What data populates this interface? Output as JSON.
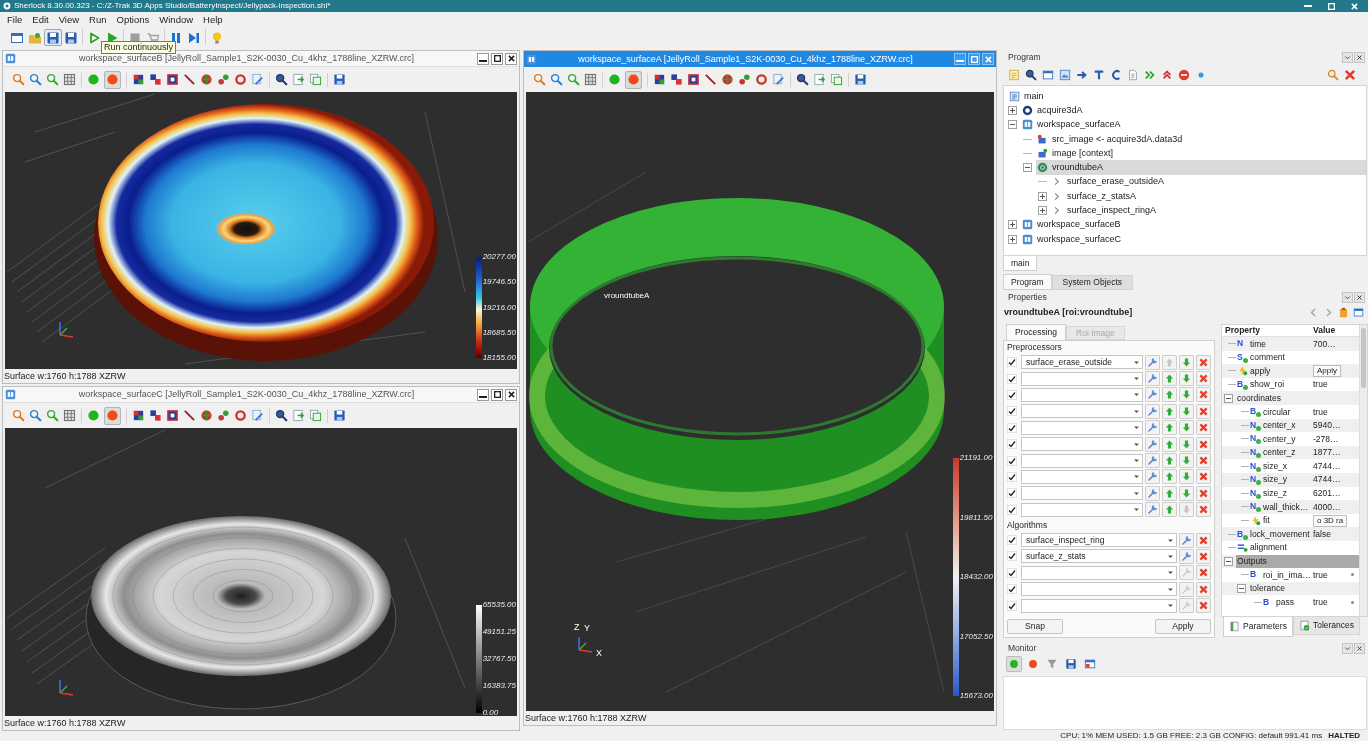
{
  "window": {
    "title": "Sherlock 8.30.00.323 - C:/Z-Trak 3D Apps Studio/BatteryInspect/Jellypack-inspection.shl*"
  },
  "menu": [
    "File",
    "Edit",
    "View",
    "Run",
    "Options",
    "Window",
    "Help"
  ],
  "toolbar": [
    {
      "kind": "new",
      "disabled": false,
      "pressed": false
    },
    {
      "kind": "open",
      "disabled": false,
      "pressed": false
    },
    {
      "kind": "save",
      "disabled": false,
      "pressed": true
    },
    {
      "kind": "save_as",
      "disabled": false,
      "pressed": false
    },
    {
      "kind": "run",
      "disabled": false,
      "pressed": false
    },
    {
      "kind": "run_continuous",
      "disabled": false,
      "pressed": false,
      "tooltip": "Run continuously"
    },
    {
      "kind": "stop",
      "disabled": true,
      "pressed": false
    },
    {
      "kind": "abort",
      "disabled": true,
      "pressed": false
    },
    {
      "kind": "pause",
      "disabled": false,
      "pressed": false
    },
    {
      "kind": "step",
      "disabled": false,
      "pressed": false
    },
    {
      "kind": "hint",
      "disabled": false,
      "pressed": false
    }
  ],
  "left_viewers": [
    {
      "title": "workspace_surfaceB [JellyRoll_Sample1_S2K-0030_Cu_4khz_1788line_XZRW.crc]",
      "active": false,
      "kind": "height_map",
      "capture_pressed": true,
      "scale": [
        "20277.00",
        "19746.50",
        "19216.00",
        "18685.50",
        "18155.00"
      ],
      "status": "Surface w:1760 h:1788 XZRW"
    },
    {
      "title": "workspace_surfaceC [JellyRoll_Sample1_S2K-0030_Cu_4khz_1788line_XZRW.crc]",
      "active": false,
      "kind": "intensity_map",
      "capture_pressed": true,
      "scale": [
        "65535.00",
        "49151.25",
        "32767.50",
        "16383.75",
        "0.00"
      ],
      "status": "Surface w:1760 h:1788 XZRW"
    }
  ],
  "main_viewer": {
    "title": "workspace_surfaceA [JellyRoll_Sample1_S2K-0030_Cu_4khz_1788line_XZRW.crc]",
    "active": true,
    "kind": "roi_view",
    "capture_pressed": true,
    "roi_label": "vroundtubeA",
    "axis_labels": [
      "Z",
      "Y",
      "X"
    ],
    "scale": [
      "21191.00",
      "19811.50",
      "18432.00",
      "17052.50",
      "15673.00"
    ],
    "status": "Surface w:1760 h:1788 XZRW"
  },
  "program": {
    "title": "Program",
    "tree": [
      {
        "label": "main",
        "kind": "program",
        "selected": false
      },
      {
        "label": "acquire3dA",
        "kind": "acquire",
        "expanded": false,
        "selected": false
      },
      {
        "label": "workspace_surfaceA",
        "kind": "workspace",
        "expanded": true,
        "selected": false,
        "children": [
          {
            "label": "src_image <- acquire3dA.data3d",
            "kind": "input",
            "selected": false
          },
          {
            "label": "image [context]",
            "kind": "output",
            "selected": false
          },
          {
            "label": "vroundtubeA",
            "kind": "roi",
            "expanded": true,
            "selected": true,
            "children": [
              {
                "label": "surface_erase_outsideA",
                "kind": "tool",
                "selected": false
              },
              {
                "label": "surface_z_statsA",
                "kind": "tool",
                "expanded": false,
                "selected": false
              },
              {
                "label": "surface_inspect_ringA",
                "kind": "tool",
                "expanded": false,
                "selected": false
              }
            ]
          }
        ]
      },
      {
        "label": "workspace_surfaceB",
        "kind": "workspace",
        "expanded": false,
        "selected": false
      },
      {
        "label": "workspace_surfaceC",
        "kind": "workspace",
        "expanded": false,
        "selected": false
      }
    ],
    "script_tabs": [
      {
        "label": "main",
        "selected": true
      }
    ],
    "tabs": [
      {
        "label": "Program",
        "selected": true
      },
      {
        "label": "System Objects",
        "selected": false
      }
    ]
  },
  "properties": {
    "title": "Properties",
    "object": "vroundtubeA [roi:vroundtube]",
    "tabs": [
      {
        "label": "Processing",
        "selected": true
      },
      {
        "label": "Roi Image",
        "selected": false
      }
    ],
    "preprocessors_label": "Preprocessors",
    "preprocessors": [
      {
        "checked": true,
        "value": "surface_erase_outside",
        "up_disabled": true,
        "down_disabled": false
      },
      {
        "checked": true,
        "up_disabled": false,
        "down_disabled": false
      },
      {
        "checked": true,
        "up_disabled": false,
        "down_disabled": false
      },
      {
        "checked": true,
        "up_disabled": false,
        "down_disabled": false
      },
      {
        "checked": true,
        "up_disabled": false,
        "down_disabled": false
      },
      {
        "checked": true,
        "up_disabled": false,
        "down_disabled": false
      },
      {
        "checked": true,
        "up_disabled": false,
        "down_disabled": false
      },
      {
        "checked": true,
        "up_disabled": false,
        "down_disabled": false
      },
      {
        "checked": true,
        "up_disabled": false,
        "down_disabled": false
      },
      {
        "checked": true,
        "up_disabled": false,
        "down_disabled": true
      }
    ],
    "algorithms_label": "Algorithms",
    "algorithms": [
      {
        "checked": true,
        "value": "surface_inspect_ring",
        "configure_disabled": false
      },
      {
        "checked": true,
        "value": "surface_z_stats",
        "configure_disabled": false
      },
      {
        "checked": true,
        "configure_disabled": true
      },
      {
        "checked": true,
        "configure_disabled": true
      },
      {
        "checked": true,
        "configure_disabled": true
      }
    ],
    "buttons": [
      "Snap",
      "Apply"
    ],
    "grid": {
      "columns": [
        "Property",
        "Value"
      ],
      "rows": [
        {
          "name": "time",
          "kind": "input",
          "badge": "N",
          "dot": false,
          "value": "700…",
          "selected": false
        },
        {
          "name": "comment",
          "kind": "input",
          "badge": "S",
          "dot": true,
          "selected": false
        },
        {
          "name": "apply",
          "kind": "action",
          "button": "Apply",
          "selected": false
        },
        {
          "name": "show_roi",
          "kind": "input",
          "badge": "B",
          "dot": true,
          "value": "true",
          "selected": false
        },
        {
          "name": "coordinates",
          "kind": "group",
          "expanded": true,
          "selected": false,
          "children": [
            {
              "name": "circular",
              "kind": "input",
              "badge": "B",
              "dot": true,
              "value": "true",
              "selected": false
            },
            {
              "name": "center_x",
              "kind": "input",
              "badge": "N",
              "dot": true,
              "value": "5940…",
              "selected": false
            },
            {
              "name": "center_y",
              "kind": "input",
              "badge": "N",
              "dot": true,
              "value": "-278…",
              "selected": false
            },
            {
              "name": "center_z",
              "kind": "input",
              "badge": "N",
              "dot": true,
              "value": "1877…",
              "selected": false
            },
            {
              "name": "size_x",
              "kind": "input",
              "badge": "N",
              "dot": true,
              "value": "4744…",
              "selected": false
            },
            {
              "name": "size_y",
              "kind": "input",
              "badge": "N",
              "dot": true,
              "value": "4744…",
              "selected": false
            },
            {
              "name": "size_z",
              "kind": "input",
              "badge": "N",
              "dot": true,
              "value": "6201…",
              "selected": false
            },
            {
              "name": "wall_thick…",
              "kind": "input",
              "badge": "N",
              "dot": true,
              "value": "4000…",
              "selected": false
            },
            {
              "name": "fit",
              "kind": "action",
              "button": "o 3D ra",
              "selected": false
            }
          ]
        },
        {
          "name": "lock_movement",
          "kind": "input",
          "badge": "B",
          "dot": true,
          "value": "false",
          "selected": false
        },
        {
          "name": "alignment",
          "kind": "object",
          "selected": false
        },
        {
          "name": "Outputs",
          "kind": "group",
          "expanded": true,
          "selected": true,
          "children": [
            {
              "name": "roi_in_ima…",
              "kind": "output",
              "badge": "B",
              "dot": false,
              "value": "true",
              "selected": false
            },
            {
              "name": "tolerance",
              "kind": "group",
              "expanded": true,
              "selected": false,
              "children": [
                {
                  "name": "pass",
                  "kind": "output",
                  "badge": "B",
                  "dot": false,
                  "value": "true",
                  "selected": false
                }
              ]
            }
          ]
        }
      ]
    },
    "grid_tabs": [
      {
        "label": "Parameters",
        "kind": "parameters",
        "selected": true
      },
      {
        "label": "Tolerances",
        "kind": "tolerances",
        "selected": false
      }
    ]
  },
  "monitor": {
    "title": "Monitor",
    "toolbar": [
      {
        "kind": "start",
        "pressed": true
      },
      {
        "kind": "stop",
        "pressed": false
      },
      {
        "kind": "filter",
        "pressed": false
      },
      {
        "kind": "save",
        "pressed": false
      },
      {
        "kind": "window",
        "pressed": false
      }
    ]
  },
  "status_bar": {
    "text": "CPU: 1% MEM USED: 1.5 GB FREE: 2.3 GB CONFIG: default 991.41 ms",
    "state": "HALTED"
  }
}
